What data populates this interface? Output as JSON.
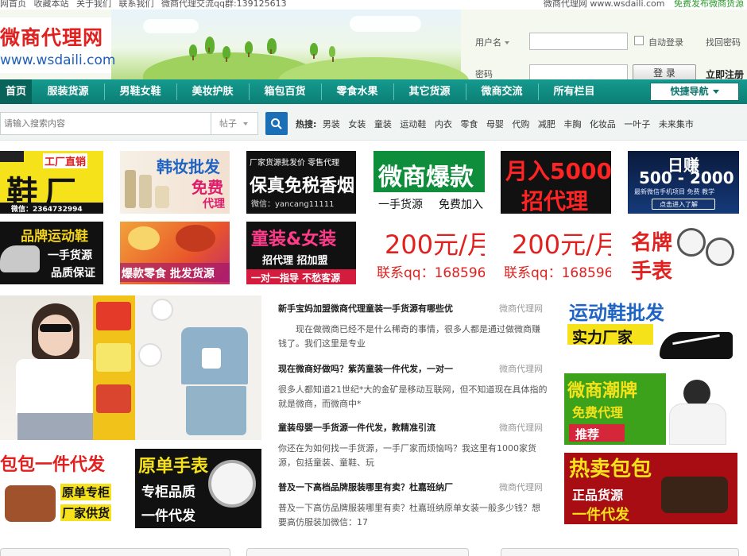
{
  "topbar": {
    "left": [
      "网首页",
      "收藏本站",
      "关于我们",
      "联系我们",
      "微商代理交流qq群:139125613"
    ],
    "site": "微商代理网 www.wsdaili.com",
    "free_post": "免费发布微商货源"
  },
  "logo": {
    "cn": "微商代理网",
    "url": "www.wsdaili.com"
  },
  "login": {
    "username_label": "用户名",
    "password_label": "密码",
    "remember": "自动登录",
    "find_pwd": "找回密码",
    "login_btn": "登 录",
    "register": "立即注册"
  },
  "nav": {
    "items": [
      "首页",
      "服装货源",
      "男鞋女鞋",
      "美妆护肤",
      "箱包百货",
      "零食水果",
      "其它货源",
      "微商交流",
      "所有栏目"
    ],
    "quick": "快捷导航"
  },
  "search": {
    "placeholder": "请输入搜索内容",
    "type": "帖子",
    "hot_label": "热搜:",
    "hot": [
      "男装",
      "女装",
      "童装",
      "运动鞋",
      "内衣",
      "零食",
      "母婴",
      "代购",
      "减肥",
      "丰胸",
      "化妆品",
      "一叶子",
      "未来集市"
    ]
  },
  "ads_row1": {
    "a1_top": "工厂直销",
    "a1_main": "鞋厂",
    "a1_sub": "微信：2364732994",
    "a2_top": "韩妆批发",
    "a2_mid": "免费",
    "a2_bot": "代理",
    "a3_top": "厂家货源批发价 零售代理",
    "a3_main": "保真免税香烟",
    "a3_sub": "微信：yancang11111",
    "a4_main": "微商爆款",
    "a4_l": "一手货源",
    "a4_r": "免费加入",
    "a5_top": "月入5000",
    "a5_bot": "招代理",
    "a6_top": "日赚",
    "a6_mid": "500 - 2000",
    "a6_sub": "最新微信手机项目 免费 教学",
    "a6_btn": "点击进入了解"
  },
  "ads_row2": {
    "b1_top": "品牌运动鞋",
    "b1_mid": "一手货源",
    "b1_bot": "品质保证",
    "b2_main": "爆款零食 批发货源",
    "b3_top": "童装&女装",
    "b3_mid": "招代理 招加盟",
    "b3_bot": "一对一指导 不愁客源",
    "b4_main": "200元/月",
    "b4_sub": "联系qq：16859633",
    "b5_main": "200元/月",
    "b5_sub": "联系qq：16859633",
    "b6_top": "名牌",
    "b6_bot": "手表"
  },
  "left_ads": {
    "bag_top": "包包一件代发",
    "bag_mid": "原单专柜",
    "bag_bot": "厂家供货",
    "watch_top": "原单手表",
    "watch_mid": "专柜品质",
    "watch_bot": "一件代发"
  },
  "right_ads": {
    "r1_top": "运动鞋批发",
    "r1_bot": "实力厂家",
    "r2_top": "微商潮牌",
    "r2_mid": "免费代理",
    "r2_bot": "推荐",
    "r3_top": "热卖包包",
    "r3_mid": "正品货源",
    "r3_bot": "一件代发"
  },
  "news": [
    {
      "title": "新手宝妈加盟微商代理童装一手货源有哪些优",
      "source": "微商代理网",
      "summary": "现在做微商已经不是什么稀奇的事情，很多人都是通过做微商赚钱了。我们这里是专业"
    },
    {
      "title": "现在微商好做吗？紫芮童装一件代发，一对一",
      "source": "微商代理网",
      "summary": "很多人都知道21世纪*大的金矿是移动互联网，但不知道现在具体指的就是微商，而微商中*"
    },
    {
      "title": "童装母婴一手货源一件代发，教精准引流",
      "source": "微商代理网",
      "summary": "你还在为如何找一手货源，一手厂家而烦恼吗？我这里有1000家货源，包括童装、童鞋、玩"
    },
    {
      "title": "普及一下高档品牌服装哪里有卖？杜嘉班纳厂",
      "source": "微商代理网",
      "summary": "普及一下高仿品牌服装哪里有卖？杜嘉班纳原单女装一般多少钱？想要高仿服装加微信：17"
    }
  ]
}
